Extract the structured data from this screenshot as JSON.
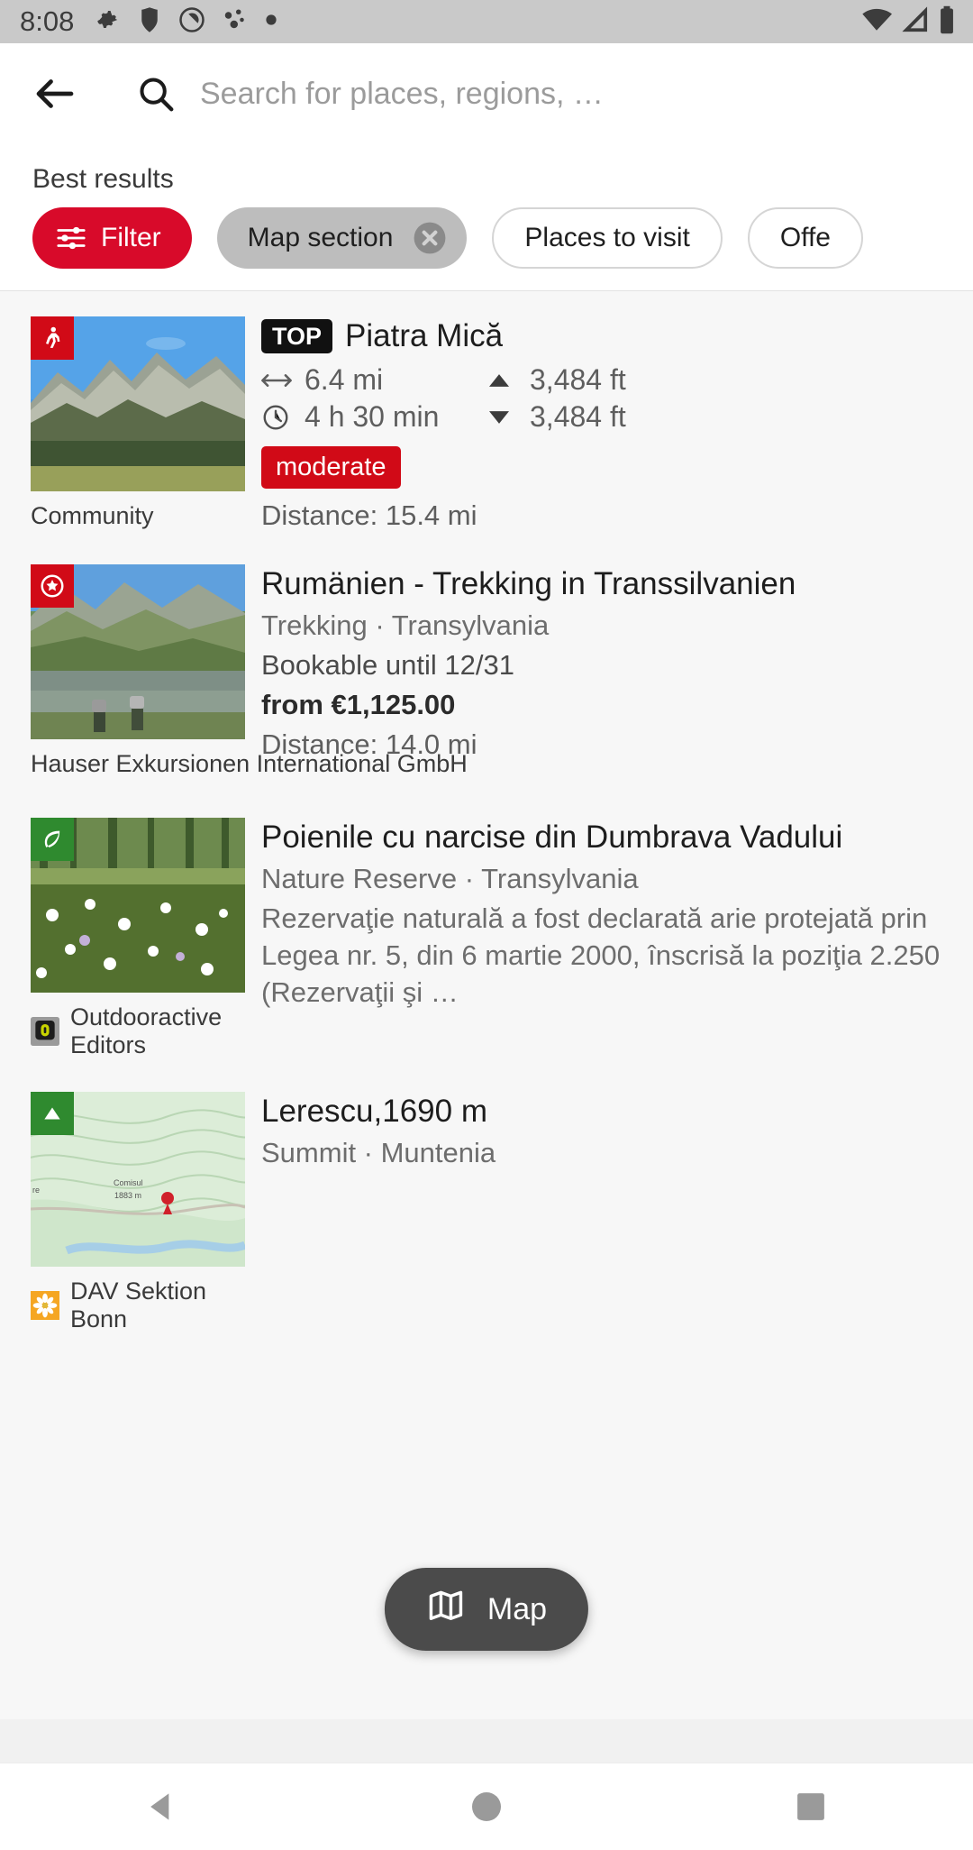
{
  "status_bar": {
    "time": "8:08",
    "left_icons": [
      "gear-icon",
      "shield-icon",
      "privacy-dot-icon",
      "bluetooth-share-icon",
      "dot-icon"
    ],
    "right_icons": [
      "wifi-icon",
      "cellular-signal-icon",
      "battery-icon"
    ]
  },
  "search": {
    "back_icon": "back-arrow-icon",
    "search_icon": "search-icon",
    "placeholder": "Search for places, regions, …",
    "value": ""
  },
  "results_header": {
    "heading": "Best results",
    "chips": [
      {
        "label": "Filter",
        "type": "primary",
        "icon": "filter-sliders-icon"
      },
      {
        "label": "Map section",
        "type": "selected",
        "icon": "close-circle-icon"
      },
      {
        "label": "Places to visit",
        "type": "outline"
      },
      {
        "label": "Offe",
        "type": "outline"
      }
    ]
  },
  "results": [
    {
      "badge": "TOP",
      "title": "Piatra Mică",
      "thumb_badge": "hiking-icon",
      "thumb_badge_color": "#d10a17",
      "stats": {
        "length_icon": "distance-arrows-icon",
        "length": "6.4 mi",
        "ascent_icon": "ascent-triangle-icon",
        "ascent": "3,484 ft",
        "duration_icon": "clock-icon",
        "duration": "4 h 30 min",
        "descent_icon": "descent-triangle-icon",
        "descent": "3,484 ft"
      },
      "difficulty": "moderate",
      "difficulty_color": "#d10a17",
      "distance": "Distance: 15.4 mi",
      "source": "Community",
      "source_logo": null
    },
    {
      "title": "Rumänien - Trekking in Transsilvanien",
      "subtitle": "Trekking · Transylvania",
      "thumb_badge": "star-circle-icon",
      "thumb_badge_color": "#d10a17",
      "bookable": "Bookable until 12/31",
      "price": "from €1,125.00",
      "distance": "Distance: 14.0 mi",
      "source": "Hauser Exkursionen International GmbH",
      "source_logo": null
    },
    {
      "title": "Poienile cu narcise din Dumbrava Vadului",
      "subtitle": "Nature Reserve · Transylvania",
      "thumb_badge": "leaf-icon",
      "thumb_badge_color": "#2f8a2f",
      "description": "Rezervaţie naturală a fost declarată arie protejată prin Legea nr. 5, din 6 martie 2000, înscrisă la poziţia 2.250 (Rezervaţii şi …",
      "source": "Outdooractive Editors",
      "source_logo": "outdooractive-logo-icon"
    },
    {
      "title": "Lerescu,1690 m",
      "subtitle": "Summit · Muntenia",
      "thumb_badge": "summit-triangle-icon",
      "thumb_badge_color": "#2f8a2f",
      "map_labels": [
        "re",
        "Comisul",
        "1883 m"
      ],
      "source": "DAV Sektion Bonn",
      "source_logo": "edelweiss-logo-icon"
    }
  ],
  "map_button": {
    "label": "Map",
    "icon": "map-icon"
  },
  "nav_bar": {
    "back": "back-triangle-icon",
    "home": "home-circle-icon",
    "recents": "recents-square-icon"
  },
  "colors": {
    "accent_red": "#d80a2a",
    "difficulty_red": "#d10a17",
    "status_bar": "#c9c9c9",
    "list_background": "#f7f7f7",
    "fab": "#4b4b4b"
  }
}
